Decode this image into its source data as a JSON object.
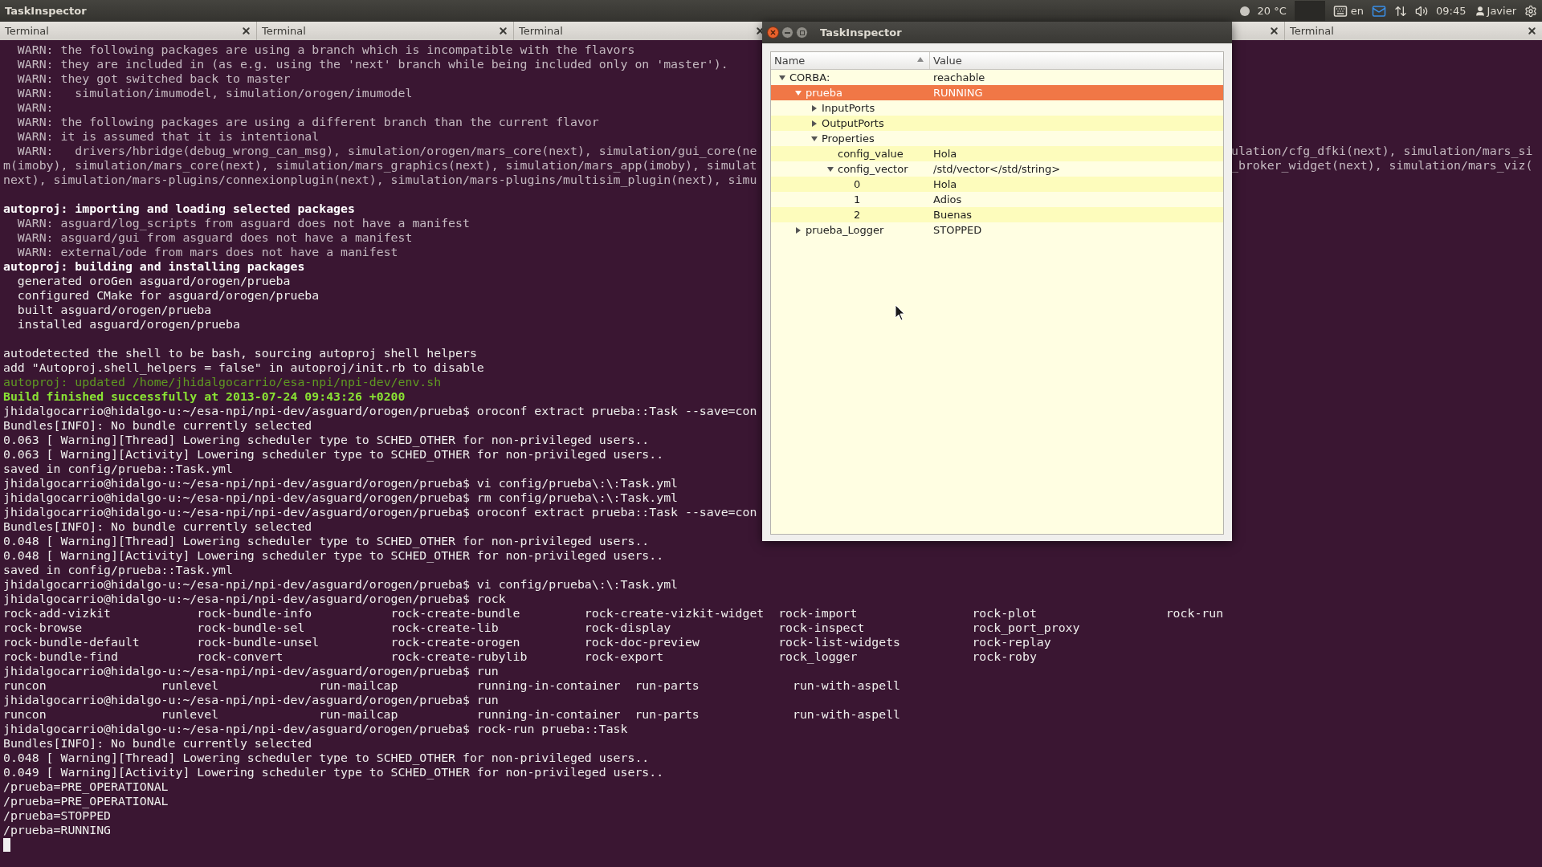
{
  "top_panel": {
    "app_name": "TaskInspector",
    "weather": "20 °C",
    "keyboard": "en",
    "clock": "09:45",
    "user": "Javier"
  },
  "tabs": [
    {
      "label": "Terminal"
    },
    {
      "label": "Terminal"
    },
    {
      "label": "Terminal"
    },
    {
      "label": "Terminal"
    }
  ],
  "terminal": {
    "lines": [
      {
        "kind": "warn",
        "text": "  WARN: the following packages are using a branch which is incompatible with the flavors"
      },
      {
        "kind": "warn",
        "text": "  WARN: they are included in (as e.g. using the 'next' branch while being included only on 'master')."
      },
      {
        "kind": "warn",
        "text": "  WARN: they got switched back to master"
      },
      {
        "kind": "warn",
        "text": "  WARN:   simulation/imumodel, simulation/orogen/imumodel"
      },
      {
        "kind": "warn",
        "text": "  WARN:"
      },
      {
        "kind": "warn",
        "text": "  WARN: the following packages are using a different branch than the current flavor"
      },
      {
        "kind": "warn",
        "text": "  WARN: it is assumed that it is intentional"
      },
      {
        "kind": "warn",
        "text": "  WARN:   drivers/hbridge(debug_wrong_can_msg), simulation/orogen/mars_core(next), simulation/gui_core(ne",
        "right_text": "ulation/cfg_dfki(next), simulation/mars_si"
      },
      {
        "kind": "warn",
        "text": "m(imoby), simulation/mars_core(next), simulation/mars_graphics(next), simulation/mars_app(imoby), simulat",
        "right_text": "_broker_widget(next), simulation/mars_viz("
      },
      {
        "kind": "warn",
        "text": "next), simulation/mars-plugins/connexionplugin(next), simulation/mars-plugins/multisim_plugin(next), simu"
      },
      {
        "kind": "blank"
      },
      {
        "kind": "heading",
        "text": "autoproj: importing and loading selected packages"
      },
      {
        "kind": "warn",
        "text": "  WARN: asguard/log_scripts from asguard does not have a manifest"
      },
      {
        "kind": "warn",
        "text": "  WARN: asguard/gui from asguard does not have a manifest"
      },
      {
        "kind": "warn",
        "text": "  WARN: external/ode from mars does not have a manifest"
      },
      {
        "kind": "heading",
        "text": "autoproj: building and installing packages"
      },
      {
        "kind": "plain",
        "text": "  generated oroGen asguard/orogen/prueba"
      },
      {
        "kind": "plain",
        "text": "  configured CMake for asguard/orogen/prueba"
      },
      {
        "kind": "plain",
        "text": "  built asguard/orogen/prueba"
      },
      {
        "kind": "plain",
        "text": "  installed asguard/orogen/prueba"
      },
      {
        "kind": "blank"
      },
      {
        "kind": "plain",
        "text": "autodetected the shell to be bash, sourcing autoproj shell helpers"
      },
      {
        "kind": "plain",
        "text": "add \"Autoproj.shell_helpers = false\" in autoproj/init.rb to disable"
      },
      {
        "kind": "note",
        "text": "autoproj: updated /home/jhidalgocarrio/esa-npi/npi-dev/env.sh"
      },
      {
        "kind": "success",
        "text": "Build finished successfully at 2013-07-24 09:43:26 +0200"
      },
      {
        "kind": "plain",
        "text": "jhidalgocarrio@hidalgo-u:~/esa-npi/npi-dev/asguard/orogen/prueba$ oroconf extract prueba::Task --save=con"
      },
      {
        "kind": "plain",
        "text": "Bundles[INFO]: No bundle currently selected"
      },
      {
        "kind": "plain",
        "text": "0.063 [ Warning][Thread] Lowering scheduler type to SCHED_OTHER for non-privileged users.."
      },
      {
        "kind": "plain",
        "text": "0.063 [ Warning][Activity] Lowering scheduler type to SCHED_OTHER for non-privileged users.."
      },
      {
        "kind": "plain",
        "text": "saved in config/prueba::Task.yml"
      },
      {
        "kind": "plain",
        "text": "jhidalgocarrio@hidalgo-u:~/esa-npi/npi-dev/asguard/orogen/prueba$ vi config/prueba\\:\\:Task.yml"
      },
      {
        "kind": "plain",
        "text": "jhidalgocarrio@hidalgo-u:~/esa-npi/npi-dev/asguard/orogen/prueba$ rm config/prueba\\:\\:Task.yml"
      },
      {
        "kind": "plain",
        "text": "jhidalgocarrio@hidalgo-u:~/esa-npi/npi-dev/asguard/orogen/prueba$ oroconf extract prueba::Task --save=con"
      },
      {
        "kind": "plain",
        "text": "Bundles[INFO]: No bundle currently selected"
      },
      {
        "kind": "plain",
        "text": "0.048 [ Warning][Thread] Lowering scheduler type to SCHED_OTHER for non-privileged users.."
      },
      {
        "kind": "plain",
        "text": "0.048 [ Warning][Activity] Lowering scheduler type to SCHED_OTHER for non-privileged users.."
      },
      {
        "kind": "plain",
        "text": "saved in config/prueba::Task.yml"
      },
      {
        "kind": "plain",
        "text": "jhidalgocarrio@hidalgo-u:~/esa-npi/npi-dev/asguard/orogen/prueba$ vi config/prueba\\:\\:Task.yml"
      },
      {
        "kind": "plain",
        "text": "jhidalgocarrio@hidalgo-u:~/esa-npi/npi-dev/asguard/orogen/prueba$ rock"
      },
      {
        "kind": "columns",
        "items": [
          "rock-add-vizkit",
          "rock-bundle-info",
          "rock-create-bundle",
          "rock-create-vizkit-widget",
          "rock-import",
          "rock-plot",
          "rock-run"
        ]
      },
      {
        "kind": "columns",
        "items": [
          "rock-browse",
          "rock-bundle-sel",
          "rock-create-lib",
          "rock-display",
          "rock-inspect",
          "rock_port_proxy"
        ]
      },
      {
        "kind": "columns",
        "items": [
          "rock-bundle-default",
          "rock-bundle-unsel",
          "rock-create-orogen",
          "rock-doc-preview",
          "rock-list-widgets",
          "rock-replay"
        ]
      },
      {
        "kind": "columns",
        "items": [
          "rock-bundle-find",
          "rock-convert",
          "rock-create-rubylib",
          "rock-export",
          "rock_logger",
          "rock-roby"
        ]
      },
      {
        "kind": "plain",
        "text": "jhidalgocarrio@hidalgo-u:~/esa-npi/npi-dev/asguard/orogen/prueba$ run"
      },
      {
        "kind": "columns",
        "items": [
          "runcon",
          "runlevel",
          "run-mailcap",
          "running-in-container",
          "run-parts",
          "run-with-aspell"
        ]
      },
      {
        "kind": "plain",
        "text": "jhidalgocarrio@hidalgo-u:~/esa-npi/npi-dev/asguard/orogen/prueba$ run"
      },
      {
        "kind": "columns",
        "items": [
          "runcon",
          "runlevel",
          "run-mailcap",
          "running-in-container",
          "run-parts",
          "run-with-aspell"
        ]
      },
      {
        "kind": "plain",
        "text": "jhidalgocarrio@hidalgo-u:~/esa-npi/npi-dev/asguard/orogen/prueba$ rock-run prueba::Task"
      },
      {
        "kind": "plain",
        "text": "Bundles[INFO]: No bundle currently selected"
      },
      {
        "kind": "plain",
        "text": "0.048 [ Warning][Thread] Lowering scheduler type to SCHED_OTHER for non-privileged users.."
      },
      {
        "kind": "plain",
        "text": "0.049 [ Warning][Activity] Lowering scheduler type to SCHED_OTHER for non-privileged users.."
      },
      {
        "kind": "plain",
        "text": "/prueba=PRE_OPERATIONAL"
      },
      {
        "kind": "plain",
        "text": "/prueba=PRE_OPERATIONAL"
      },
      {
        "kind": "plain",
        "text": "/prueba=STOPPED"
      },
      {
        "kind": "plain",
        "text": "/prueba=RUNNING"
      }
    ]
  },
  "task_inspector": {
    "title": "TaskInspector",
    "columns": [
      "Name",
      "Value"
    ],
    "tree": [
      {
        "name": "CORBA:",
        "value": "reachable",
        "expanded": true,
        "selected": false,
        "children": [
          {
            "name": "prueba",
            "value": "RUNNING",
            "expanded": true,
            "selected": true,
            "children": [
              {
                "name": "InputPorts",
                "expanded": false,
                "selected": false
              },
              {
                "name": "OutputPorts",
                "expanded": false,
                "selected": false
              },
              {
                "name": "Properties",
                "expanded": true,
                "selected": false,
                "children": [
                  {
                    "name": "config_value",
                    "value": "Hola",
                    "selected": false
                  },
                  {
                    "name": "config_vector",
                    "value": "/std/vector</std/string>",
                    "expanded": true,
                    "selected": false,
                    "children": [
                      {
                        "name": "0",
                        "value": "Hola",
                        "selected": false
                      },
                      {
                        "name": "1",
                        "value": "Adios",
                        "selected": false
                      },
                      {
                        "name": "2",
                        "value": "Buenas",
                        "selected": false
                      }
                    ]
                  }
                ]
              }
            ]
          },
          {
            "name": "prueba_Logger",
            "value": "STOPPED",
            "expanded": false,
            "selected": false
          }
        ]
      }
    ]
  }
}
